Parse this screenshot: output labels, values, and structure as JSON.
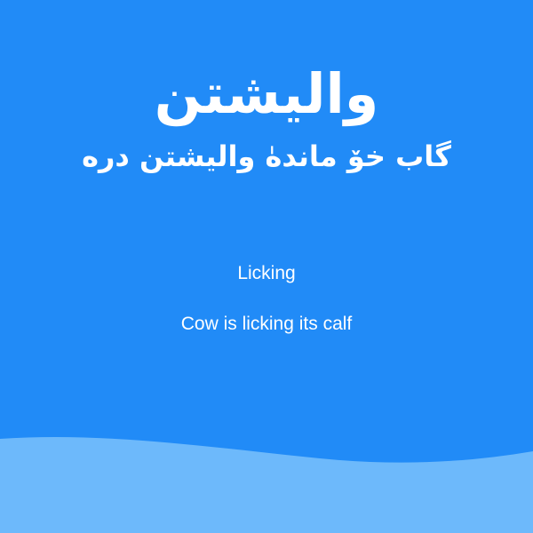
{
  "card": {
    "title": "واليشتن",
    "subtitle": "گاب خۆ ماندهٰ واليشتن دره",
    "english_word": "Licking",
    "english_sentence": "Cow is licking its calf"
  },
  "colors": {
    "background": "#218bf7",
    "wave": "#6db9fb",
    "text": "#ffffff"
  }
}
